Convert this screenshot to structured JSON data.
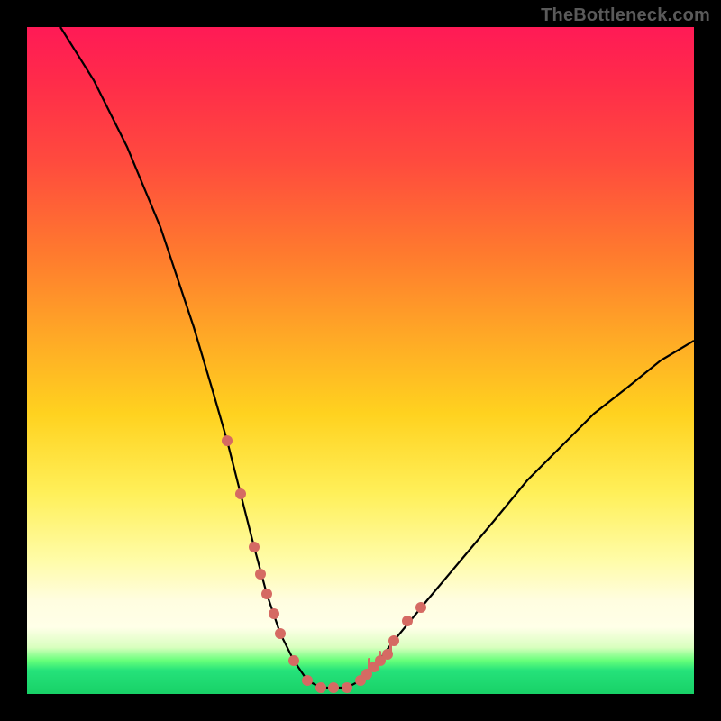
{
  "watermark": "TheBottleneck.com",
  "chart_data": {
    "type": "line",
    "title": "",
    "xlabel": "",
    "ylabel": "",
    "xlim": [
      0,
      100
    ],
    "ylim": [
      0,
      100
    ],
    "grid": false,
    "legend": false,
    "series": [
      {
        "name": "bottleneck-curve",
        "x": [
          5,
          10,
          15,
          20,
          25,
          28,
          30,
          32,
          34,
          36,
          38,
          40,
          42,
          44,
          46,
          48,
          50,
          52,
          55,
          60,
          65,
          70,
          75,
          80,
          85,
          90,
          95,
          100
        ],
        "values": [
          100,
          92,
          82,
          70,
          55,
          45,
          38,
          30,
          22,
          15,
          9,
          5,
          2,
          1,
          1,
          1,
          2,
          4,
          8,
          14,
          20,
          26,
          32,
          37,
          42,
          46,
          50,
          53
        ]
      }
    ],
    "markers": {
      "name": "highlighted-points",
      "x": [
        30,
        32,
        34,
        35,
        36,
        37,
        38,
        40,
        42,
        44,
        46,
        48,
        50,
        51,
        52,
        53,
        54,
        55,
        57,
        59
      ],
      "values": [
        38,
        30,
        22,
        18,
        15,
        12,
        9,
        5,
        2,
        1,
        1,
        1,
        2,
        3,
        4,
        5,
        6,
        8,
        11,
        13
      ]
    },
    "gradient_bands": [
      {
        "label": "high-bottleneck",
        "color": "#ff1a56",
        "y": 100
      },
      {
        "label": "",
        "color": "#ff7a2e",
        "y": 66
      },
      {
        "label": "",
        "color": "#ffd21f",
        "y": 42
      },
      {
        "label": "",
        "color": "#fffde0",
        "y": 12
      },
      {
        "label": "optimal",
        "color": "#25e27a",
        "y": 3
      }
    ]
  }
}
